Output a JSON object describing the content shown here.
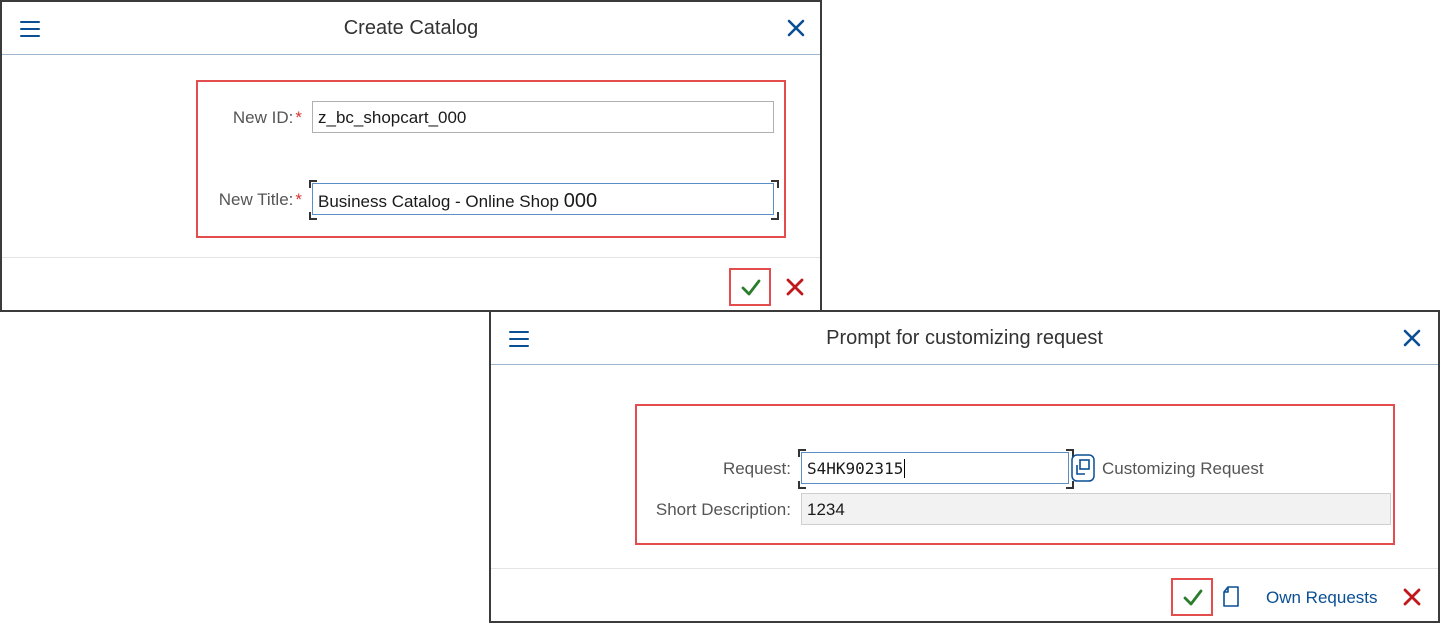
{
  "create_catalog": {
    "title": "Create Catalog",
    "new_id_label": "New ID:",
    "new_id_value": "z_bc_shopcart_000",
    "new_title_label": "New Title:",
    "new_title_value_main": "Business Catalog - Online Shop",
    "new_title_value_suffix": "000",
    "required_mark": "*"
  },
  "customizing_prompt": {
    "title": "Prompt for customizing request",
    "request_label": "Request:",
    "request_value": "S4HK902315",
    "request_type": "Customizing Request",
    "short_desc_label": "Short Description:",
    "short_desc_value": "1234",
    "own_requests_label": "Own Requests"
  },
  "colors": {
    "accent": "#0a4f94",
    "confirm_green": "#2b7d2b",
    "cancel_red": "#c0181b",
    "highlight_red": "#e44d4d"
  },
  "icons": [
    "menu-icon",
    "close-icon",
    "checkmark-icon",
    "cancel-icon",
    "value-help-icon",
    "new-document-icon"
  ]
}
